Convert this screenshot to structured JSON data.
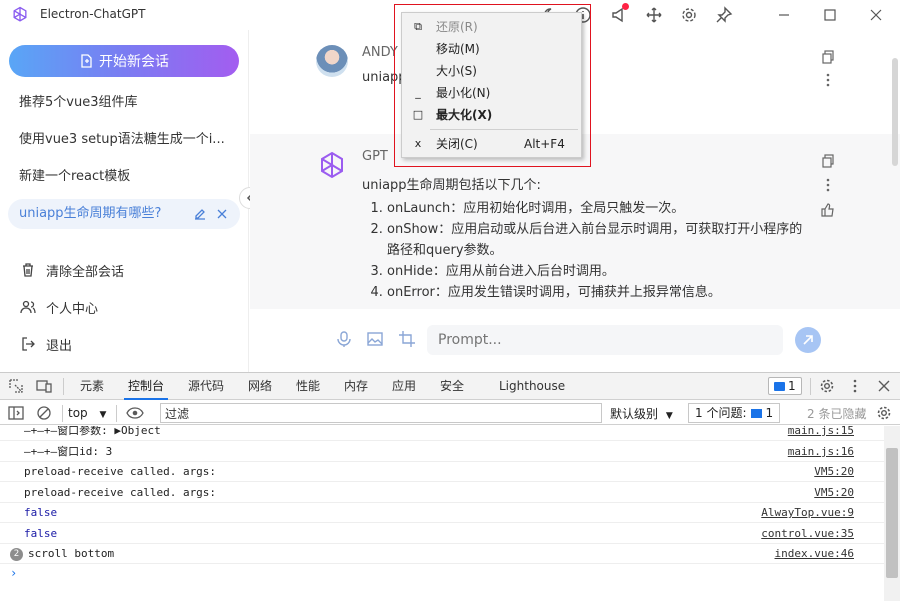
{
  "window": {
    "title": "Electron-ChatGPT"
  },
  "sidebar": {
    "new_chat_label": "开始新会话",
    "conversations": [
      {
        "title": "推荐5个vue3组件库"
      },
      {
        "title": "使用vue3 setup语法糖生成一个i..."
      },
      {
        "title": "新建一个react模板"
      },
      {
        "title": "uniapp生命周期有哪些?"
      }
    ],
    "footer": [
      {
        "label": "清除全部会话",
        "icon": "trash-icon"
      },
      {
        "label": "个人中心",
        "icon": "users-icon"
      },
      {
        "label": "退出",
        "icon": "logout-icon"
      }
    ]
  },
  "chat": {
    "user_message": {
      "name": "ANDY",
      "text": "uniapp"
    },
    "gpt_message": {
      "name": "GPT",
      "intro": "uniapp生命周期包括以下几个:",
      "items": [
        "onLaunch：应用初始化时调用，全局只触发一次。",
        "onShow：应用启动或从后台进入前台显示时调用，可获取打开小程序的路径和query参数。",
        "onHide：应用从前台进入后台时调用。",
        "onError：应用发生错误时调用，可捕获并上报异常信息。"
      ]
    },
    "prompt_placeholder": "Prompt..."
  },
  "context_menu": {
    "items": [
      {
        "glyph": "⧉",
        "label": "还原(R)",
        "shortcut": "",
        "disabled": true,
        "bold": false
      },
      {
        "glyph": "",
        "label": "移动(M)",
        "shortcut": "",
        "disabled": false,
        "bold": false
      },
      {
        "glyph": "",
        "label": "大小(S)",
        "shortcut": "",
        "disabled": false,
        "bold": false
      },
      {
        "glyph": "_",
        "label": "最小化(N)",
        "shortcut": "",
        "disabled": false,
        "bold": false
      },
      {
        "glyph": "□",
        "label": "最大化(X)",
        "shortcut": "",
        "disabled": false,
        "bold": true
      },
      {
        "glyph": "x",
        "label": "关闭(C)",
        "shortcut": "Alt+F4",
        "disabled": false,
        "bold": false
      }
    ]
  },
  "devtools": {
    "tabs": [
      "元素",
      "控制台",
      "源代码",
      "网络",
      "性能",
      "内存",
      "应用",
      "安全",
      "Lighthouse"
    ],
    "active_tab": "控制台",
    "issues_badge_count": "1",
    "context": "top",
    "filter_value": "过滤",
    "log_level": "默认级别",
    "issues_label": "1 个问题:",
    "issues_count": "1",
    "hidden_label": "2 条已隐藏",
    "logs": [
      {
        "text": "—+—+—窗口参数: ▶Object",
        "source": "main.js:15",
        "style": "normal",
        "count": ""
      },
      {
        "text": "—+—+—窗口id: 3",
        "source": "main.js:16",
        "style": "normal",
        "count": ""
      },
      {
        "text": "preload-receive called. args:",
        "source": "VM5:20",
        "style": "normal",
        "count": ""
      },
      {
        "text": "preload-receive called. args:",
        "source": "VM5:20",
        "style": "normal",
        "count": ""
      },
      {
        "text": "false",
        "source": "AlwayTop.vue:9",
        "style": "blue",
        "count": ""
      },
      {
        "text": "false",
        "source": "control.vue:35",
        "style": "blue",
        "count": ""
      },
      {
        "text": "scroll bottom",
        "source": "index.vue:46",
        "style": "normal",
        "count": "2"
      }
    ]
  }
}
